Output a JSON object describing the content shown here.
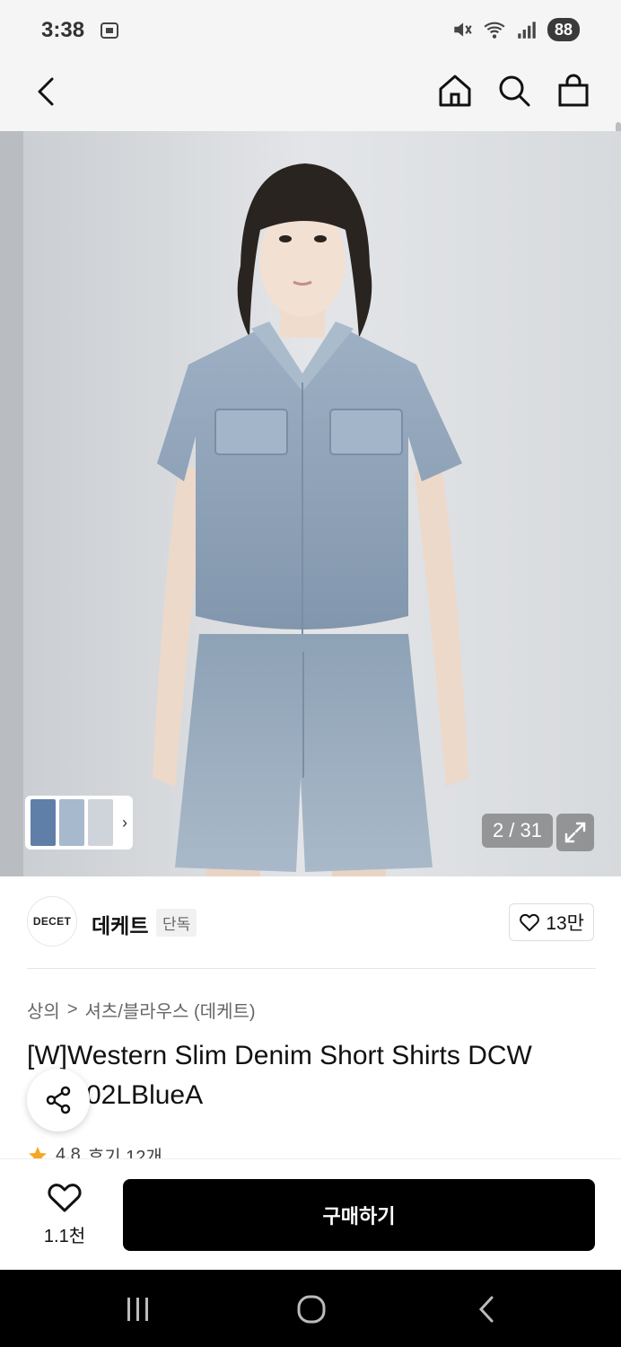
{
  "status": {
    "time": "3:38",
    "battery": "88",
    "icons": [
      "screenshot-icon",
      "mute-icon",
      "wifi-icon",
      "signal-icon"
    ]
  },
  "app_bar": {
    "icons": [
      "back-icon",
      "home-icon",
      "search-icon",
      "bag-icon"
    ]
  },
  "gallery": {
    "counter": "2 / 31",
    "thumbnail_arrow": "›"
  },
  "brand": {
    "logo_text": "DECET",
    "name": "데케트",
    "badge": "단독",
    "likes": "13만"
  },
  "product": {
    "breadcrumb": [
      "상의",
      "셔츠/블라우스 (데케트)"
    ],
    "breadcrumb_sep": ">",
    "title": "[W]Western Slim Denim Short Shirts DCW",
    "title_line2": "02LBlueA",
    "rating": "4.8",
    "reviews": "후기 12개"
  },
  "cta": {
    "wish_count": "1.1천",
    "buy_label": "구매하기"
  },
  "colors": {
    "accent_star": "#f5a623",
    "buy_button": "#000000",
    "bar_bg": "#f5f5f5"
  }
}
